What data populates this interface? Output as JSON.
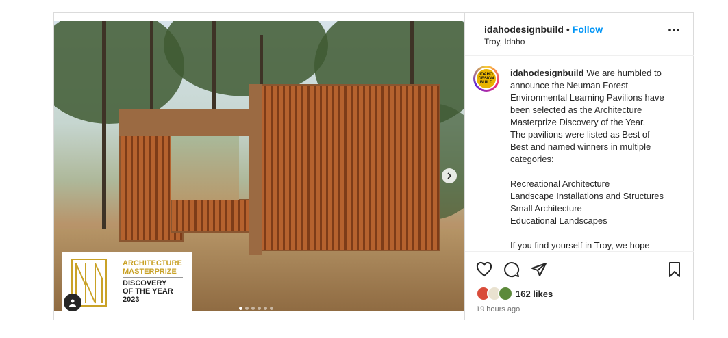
{
  "post": {
    "username": "idahodesignbuild",
    "follow_label": "Follow",
    "location": "Troy, Idaho",
    "caption_lines": [
      "We are humbled to",
      "announce the Neuman Forest",
      "Environmental Learning Pavilions have",
      "been selected as the Architecture",
      "Masterprize Discovery of the Year.",
      "The pavilions were listed as Best of",
      "Best and named winners in multiple",
      "categories:"
    ],
    "categories": [
      "Recreational Architecture",
      "Landscape Installations and Structures",
      "Small Architecture",
      "Educational Landscapes"
    ],
    "caption_tail": "If you find yourself in Troy, we hope",
    "likes": "162 likes",
    "time_ago": "19 hours ago",
    "avatar_text": "IDAHO DESIGN BUILD"
  },
  "media": {
    "badge_line1": "ARCHITECTURE",
    "badge_line2": "MASTERPRIZE",
    "badge_line3": "DISCOVERY",
    "badge_line4": "OF THE YEAR",
    "badge_line5": "2023",
    "carousel_pages": 6,
    "carousel_active": 1
  },
  "icons": {
    "more": "more-horizontal-icon",
    "next": "chevron-right-icon",
    "like": "heart-icon",
    "comment": "comment-icon",
    "share": "share-icon",
    "save": "bookmark-icon",
    "user_tag": "user-icon"
  },
  "colors": {
    "follow": "#0095f6",
    "badge_gold": "#c9a227"
  }
}
